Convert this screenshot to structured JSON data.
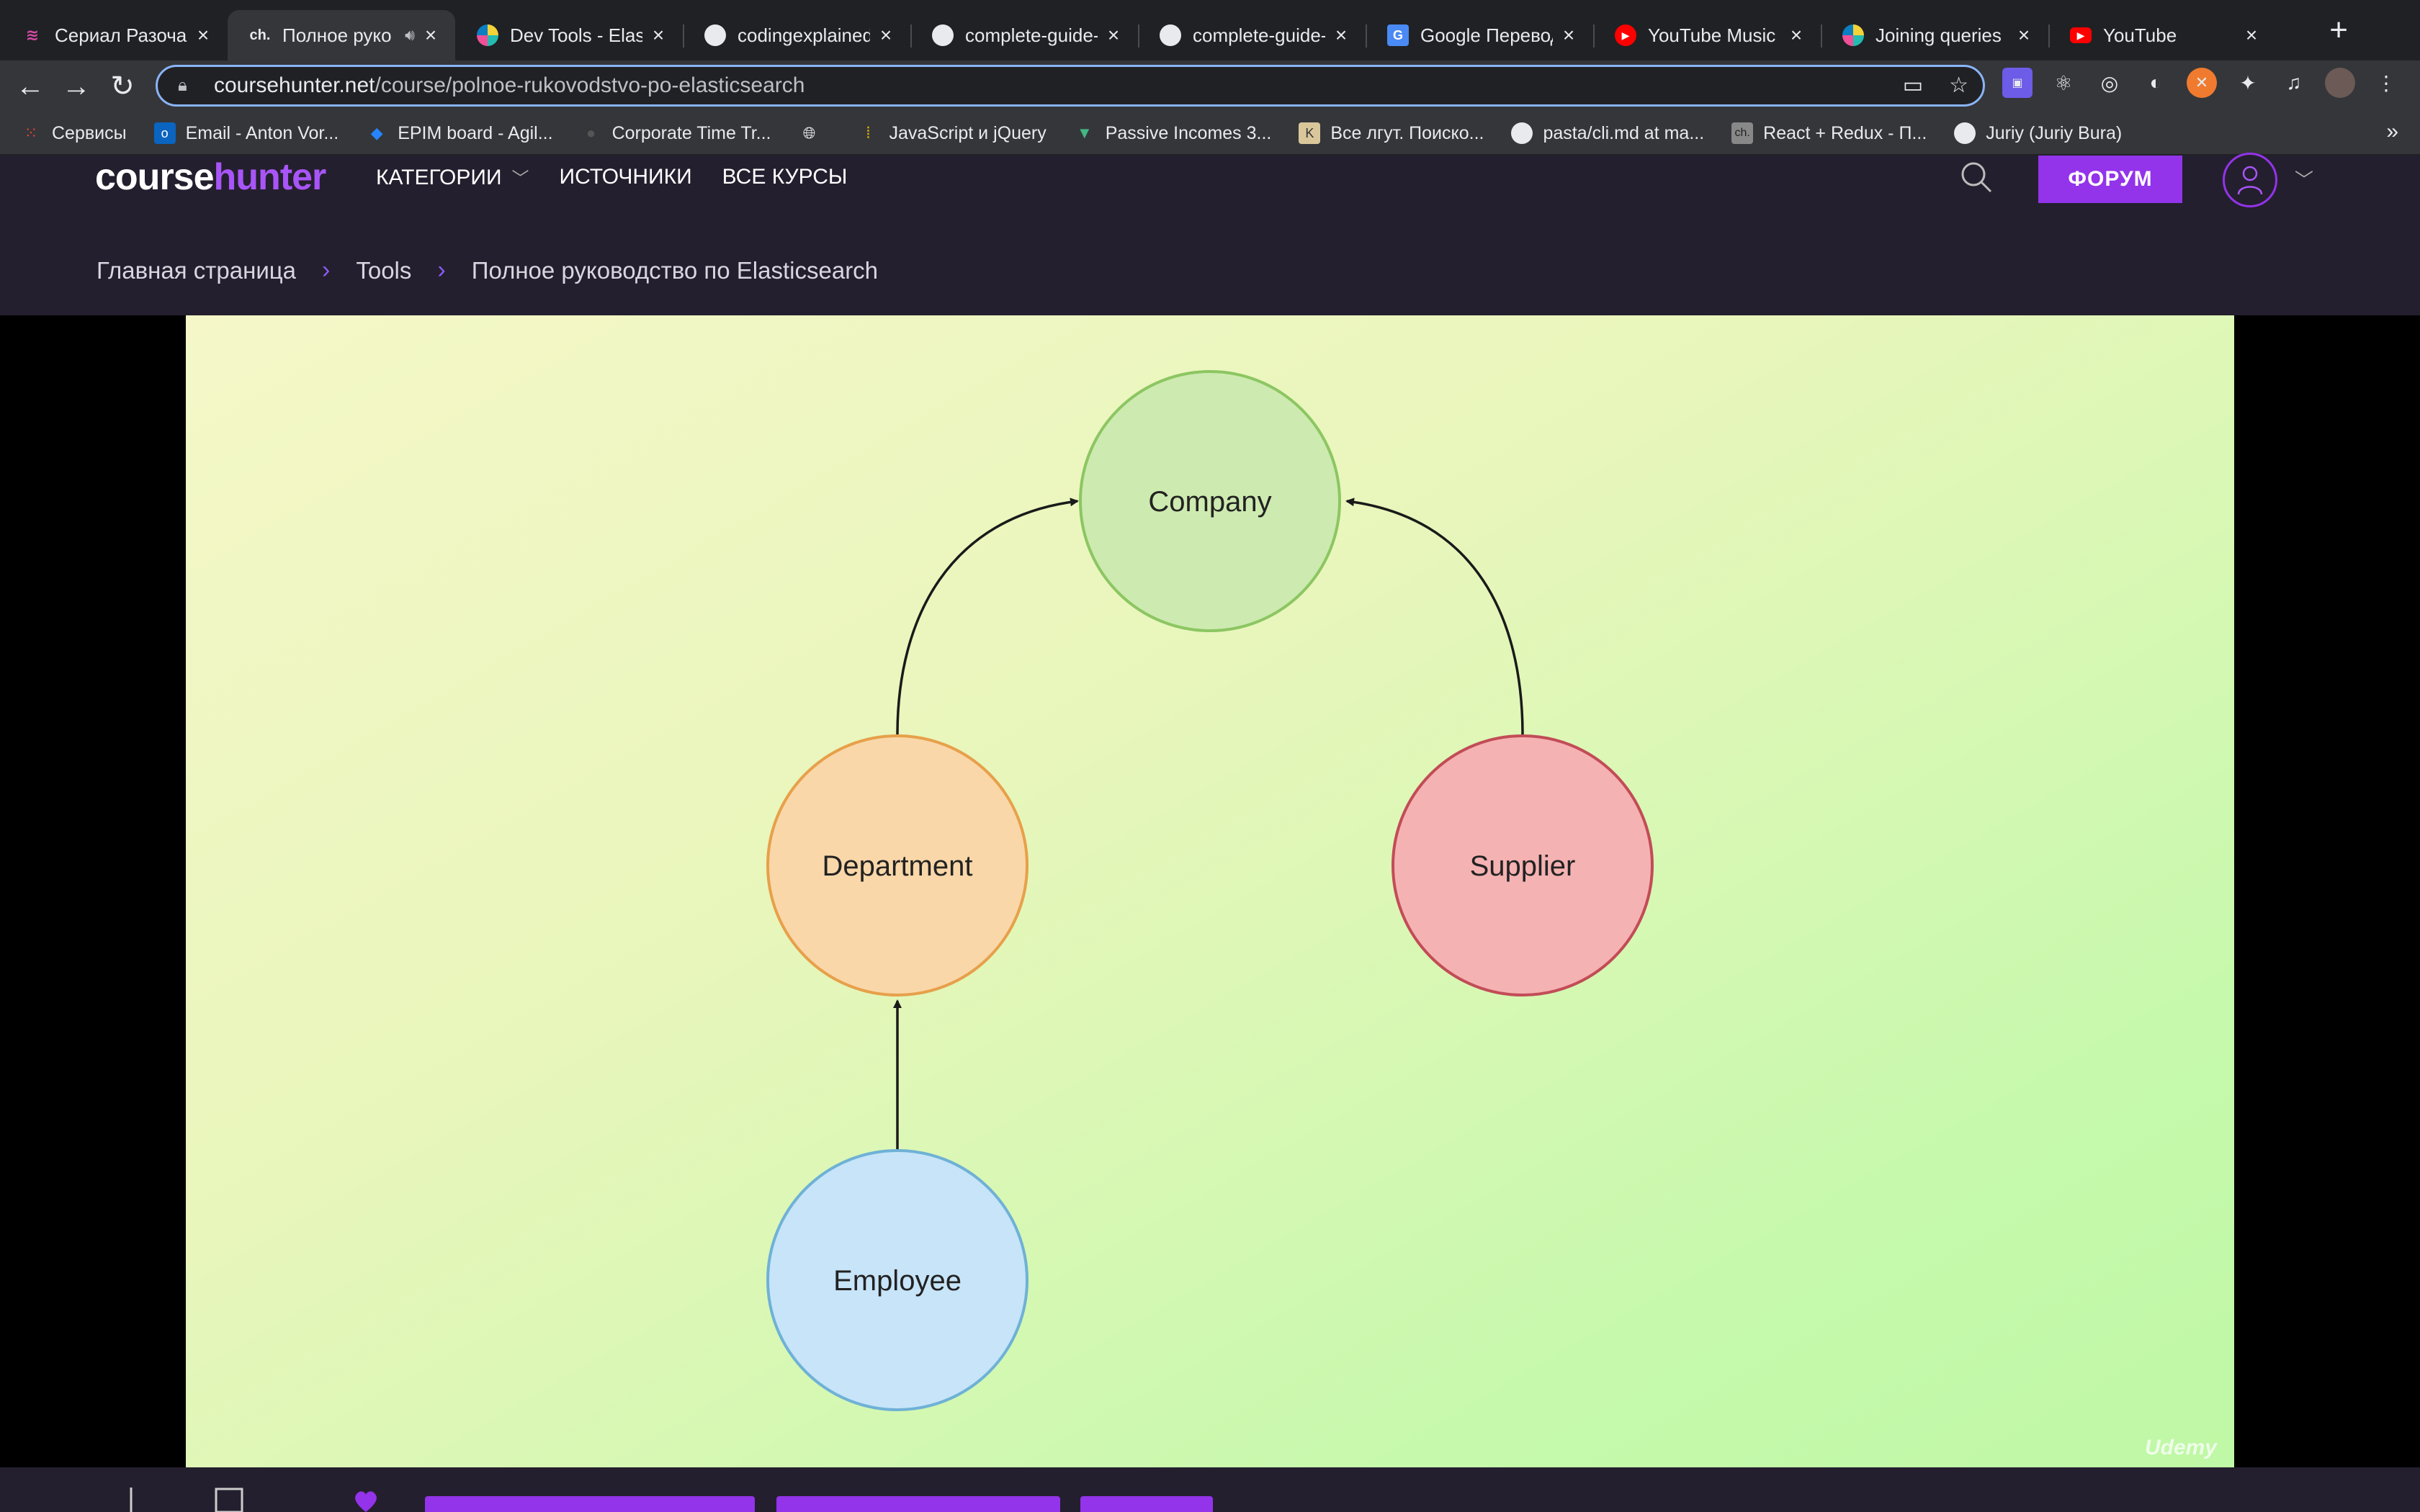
{
  "browser": {
    "tabs": [
      {
        "title": "Сериал Разочар",
        "icon": "serial-favicon",
        "active": false
      },
      {
        "title": "Полное руко",
        "icon": "coursehunter-favicon",
        "active": true,
        "audio": true
      },
      {
        "title": "Dev Tools - Elast",
        "icon": "elastic-favicon",
        "active": false
      },
      {
        "title": "codingexplained",
        "icon": "github-icon",
        "active": false
      },
      {
        "title": "complete-guide-",
        "icon": "github-icon",
        "active": false
      },
      {
        "title": "complete-guide-",
        "icon": "github-icon",
        "active": false
      },
      {
        "title": "Google Перевод",
        "icon": "google-translate-icon",
        "active": false
      },
      {
        "title": "YouTube Music",
        "icon": "youtube-music-icon",
        "active": false
      },
      {
        "title": "Joining queries |",
        "icon": "elastic-favicon",
        "active": false
      },
      {
        "title": "YouTube",
        "icon": "youtube-icon",
        "active": false
      }
    ],
    "url_host": "coursehunter.net",
    "url_path": "/course/polnoe-rukovodstvo-po-elasticsearch",
    "bookmarks": [
      {
        "label": "Сервисы",
        "icon": "apps-grid-icon"
      },
      {
        "label": "Email - Anton Vor...",
        "icon": "outlook-icon"
      },
      {
        "label": "EPIM board - Agil...",
        "icon": "jira-icon"
      },
      {
        "label": "Corporate Time Tr...",
        "icon": "clock-icon"
      },
      {
        "label": "",
        "icon": "globe-icon"
      },
      {
        "label": "JavaScript и jQuery",
        "icon": "bookmark-bars-icon"
      },
      {
        "label": "Passive Incomes 3...",
        "icon": "vue-icon"
      },
      {
        "label": "Все лгут. Поиско...",
        "icon": "book-icon"
      },
      {
        "label": "pasta/cli.md at ma...",
        "icon": "github-icon"
      },
      {
        "label": "React + Redux - П...",
        "icon": "coursehunter-favicon"
      },
      {
        "label": "Juriy (Juriy Bura)",
        "icon": "github-icon"
      }
    ]
  },
  "site": {
    "logo_course": "course",
    "logo_hunter": "hunter",
    "nav": {
      "categories": "КАТЕГОРИИ",
      "sources": "ИСТОЧНИКИ",
      "all_courses": "ВСЕ КУРСЫ"
    },
    "forum_button": "ФОРУМ",
    "breadcrumb": {
      "home": "Главная страница",
      "section": "Tools",
      "current": "Полное руководство по Elasticsearch"
    }
  },
  "video": {
    "diagram": {
      "nodes": [
        {
          "id": "company",
          "label": "Company",
          "color": "#cdeab0",
          "stroke": "#8cc662"
        },
        {
          "id": "department",
          "label": "Department",
          "color": "#f9d7a9",
          "stroke": "#e7a04a"
        },
        {
          "id": "supplier",
          "label": "Supplier",
          "color": "#f5b2b2",
          "stroke": "#c24c57"
        },
        {
          "id": "employee",
          "label": "Employee",
          "color": "#c7e4f8",
          "stroke": "#6fb1d6"
        }
      ],
      "edges": [
        {
          "from": "department",
          "to": "company"
        },
        {
          "from": "supplier",
          "to": "company"
        },
        {
          "from": "employee",
          "to": "department"
        }
      ]
    },
    "watermark": "Udemy"
  }
}
